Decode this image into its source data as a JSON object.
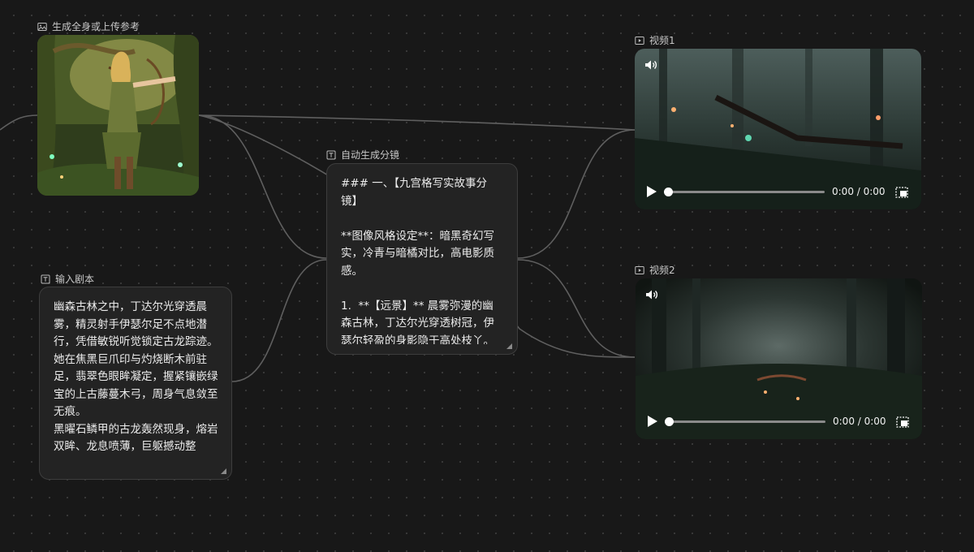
{
  "nodes": {
    "reference": {
      "label": "生成全身或上传参考",
      "icon": "image-icon"
    },
    "script": {
      "label": "输入剧本",
      "icon": "text-box-icon",
      "text": "幽森古林之中，丁达尔光穿透晨雾，精灵射手伊瑟尔足不点地潜行，凭借敏锐听觉锁定古龙踪迹。\n她在焦黑巨爪印与灼烧断木前驻足，翡翠色眼眸凝定，握紧镶嵌绿宝的上古藤蔓木弓，周身气息敛至无痕。\n黑曜石鳞甲的古龙轰然现身，熔岩双眸、龙息喷薄，巨躯撼动整"
    },
    "storyboard": {
      "label": "自动生成分镜",
      "icon": "text-box-icon",
      "text": "### 一、【九宫格写实故事分镜】\n\n**图像风格设定**：暗黑奇幻写实，冷青与暗橘对比，高电影质感。\n\n1.  **【远景】** 晨雾弥漫的幽森古林，丁达尔光穿透树冠，伊瑟尔轻盈的身影隐于高处枝丫。"
    },
    "video1": {
      "label": "视频1",
      "icon": "video-icon",
      "time": "0:00 / 0:00",
      "progress": 0
    },
    "video2": {
      "label": "视频2",
      "icon": "video-icon",
      "time": "0:00 / 0:00",
      "progress": 0
    }
  },
  "colors": {
    "canvas": "#181818",
    "card": "#232323",
    "wire": "#6a6a6a"
  }
}
